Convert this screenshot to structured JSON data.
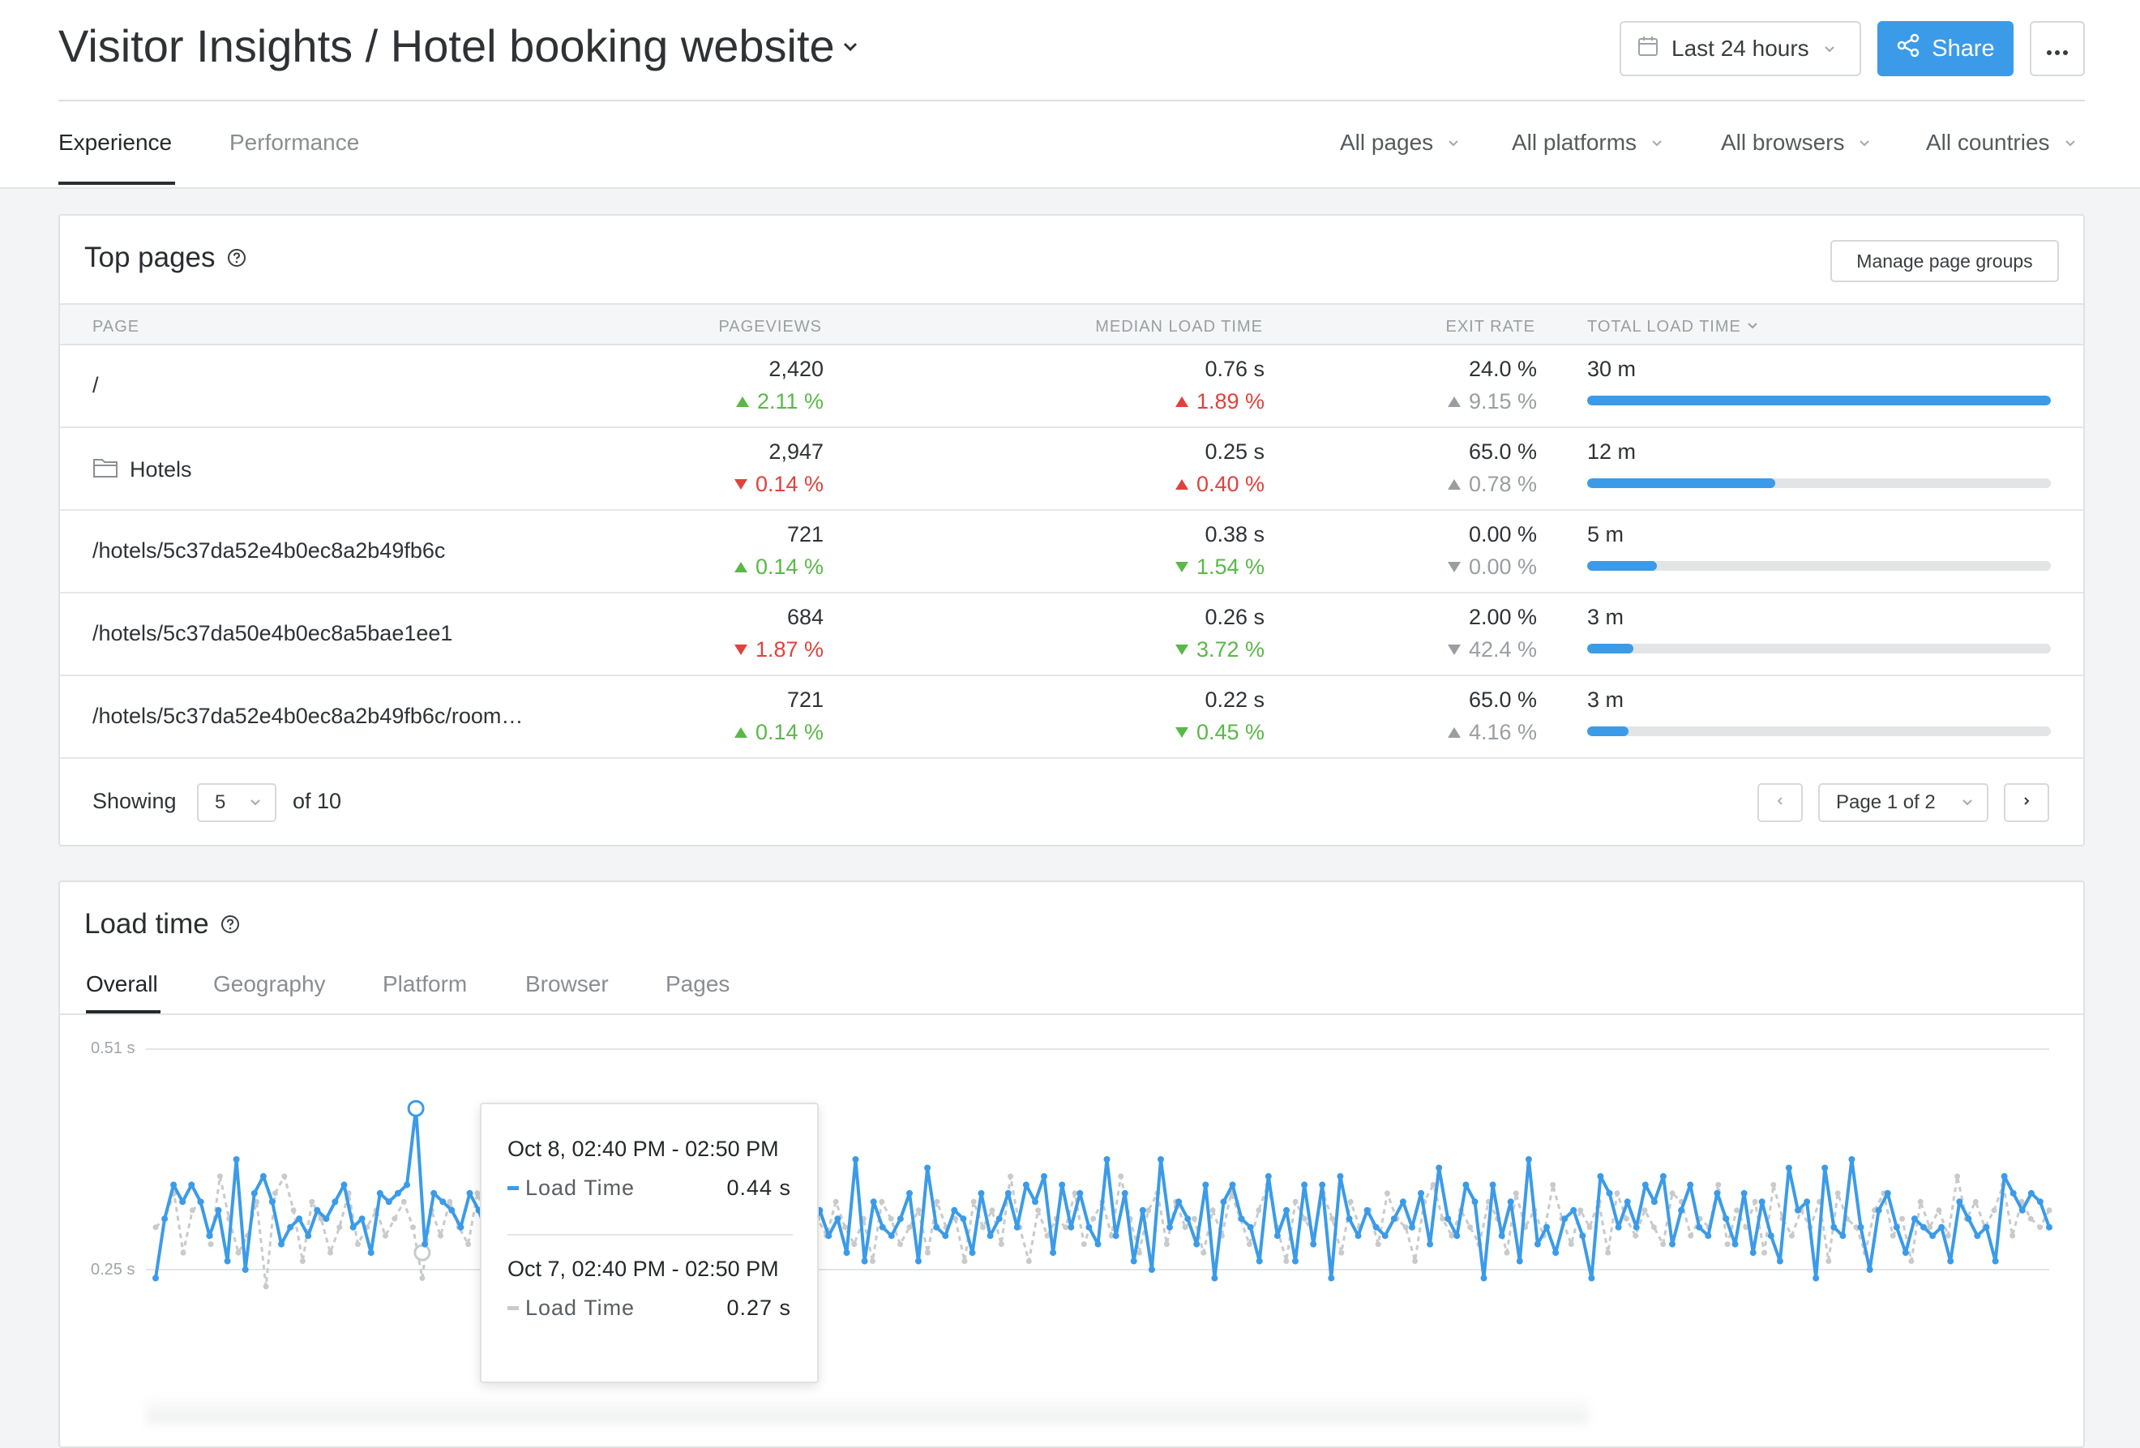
{
  "header": {
    "title": "Visitor Insights / Hotel booking website",
    "date_range": "Last 24 hours",
    "share_label": "Share"
  },
  "tabs": [
    {
      "label": "Experience",
      "active": true
    },
    {
      "label": "Performance",
      "active": false
    }
  ],
  "filters": [
    "All pages",
    "All platforms",
    "All browsers",
    "All countries"
  ],
  "top_pages": {
    "title": "Top pages",
    "manage_label": "Manage page groups",
    "columns": {
      "page": "PAGE",
      "pageviews": "PAGEVIEWS",
      "median_load": "MEDIAN LOAD TIME",
      "exit_rate": "EXIT RATE",
      "total_load": "TOTAL LOAD TIME"
    },
    "rows": [
      {
        "page": "/",
        "is_group": false,
        "pageviews": "2,420",
        "pv_delta": "2.11 %",
        "pv_dir": "up-green",
        "median": "0.76 s",
        "med_delta": "1.89 %",
        "med_dir": "up-red",
        "exit": "24.0 %",
        "exit_delta": "9.15 %",
        "exit_dir": "up-neutral",
        "total": "30 m",
        "total_fraction": 1.0
      },
      {
        "page": "Hotels",
        "is_group": true,
        "pageviews": "2,947",
        "pv_delta": "0.14 %",
        "pv_dir": "down-red",
        "median": "0.25 s",
        "med_delta": "0.40 %",
        "med_dir": "up-red",
        "exit": "65.0 %",
        "exit_delta": "0.78 %",
        "exit_dir": "up-neutral",
        "total": "12 m",
        "total_fraction": 0.405
      },
      {
        "page": "/hotels/5c37da52e4b0ec8a2b49fb6c",
        "is_group": false,
        "pageviews": "721",
        "pv_delta": "0.14 %",
        "pv_dir": "up-green",
        "median": "0.38 s",
        "med_delta": "1.54 %",
        "med_dir": "down-green",
        "exit": "0.00 %",
        "exit_delta": "0.00 %",
        "exit_dir": "down-neutral",
        "total": "5 m",
        "total_fraction": 0.15
      },
      {
        "page": "/hotels/5c37da50e4b0ec8a5bae1ee1",
        "is_group": false,
        "pageviews": "684",
        "pv_delta": "1.87 %",
        "pv_dir": "down-red",
        "median": "0.26 s",
        "med_delta": "3.72 %",
        "med_dir": "down-green",
        "exit": "2.00 %",
        "exit_delta": "42.4 %",
        "exit_dir": "down-neutral",
        "total": "3 m",
        "total_fraction": 0.1
      },
      {
        "page": "/hotels/5c37da52e4b0ec8a2b49fb6c/room…",
        "is_group": false,
        "pageviews": "721",
        "pv_delta": "0.14 %",
        "pv_dir": "up-green",
        "median": "0.22 s",
        "med_delta": "0.45 %",
        "med_dir": "down-green",
        "exit": "65.0 %",
        "exit_delta": "4.16 %",
        "exit_dir": "up-neutral",
        "total": "3 m",
        "total_fraction": 0.09
      }
    ],
    "footer": {
      "showing_label": "Showing",
      "page_size": "5",
      "of_label": "of 10",
      "page_select": "Page 1 of 2"
    }
  },
  "load_time": {
    "title": "Load time",
    "subtabs": [
      "Overall",
      "Geography",
      "Platform",
      "Browser",
      "Pages"
    ],
    "active_subtab": "Overall",
    "tooltip": {
      "current_range": "Oct 8, 02:40 PM - 02:50 PM",
      "current_label": "Load Time",
      "current_value": "0.44 s",
      "previous_range": "Oct 7, 02:40 PM - 02:50 PM",
      "previous_label": "Load Time",
      "previous_value": "0.27 s"
    }
  },
  "colors": {
    "accent": "#3b9be8",
    "green": "#58b947",
    "red": "#e2413b",
    "neutral": "#9a9ea2",
    "previous_series": "#c8cacc"
  },
  "chart_data": {
    "type": "line",
    "ytick_labels": [
      "0.25 s",
      "0.51 s"
    ],
    "ylim": [
      0.25,
      0.51
    ],
    "grid": true,
    "series": [
      {
        "values": [
          0.24,
          0.31,
          0.35,
          0.33,
          0.35,
          0.33,
          0.29,
          0.32,
          0.26,
          0.38,
          0.25,
          0.34,
          0.36,
          0.33,
          0.28,
          0.3,
          0.31,
          0.29,
          0.32,
          0.31,
          0.33,
          0.35,
          0.3,
          0.31,
          0.27,
          0.34,
          0.33,
          0.34,
          0.35,
          0.44,
          0.28,
          0.34,
          0.33,
          0.32,
          0.3,
          0.34,
          0.32,
          0.29,
          0.36,
          0.33,
          0.29,
          0.28,
          0.32,
          0.31,
          0.28,
          0.34,
          0.31,
          0.28,
          0.33,
          0.36,
          0.35,
          0.3,
          0.32,
          0.29,
          0.31,
          0.26,
          0.35,
          0.33,
          0.31,
          0.3,
          0.32,
          0.29,
          0.38,
          0.25,
          0.34,
          0.31,
          0.3,
          0.26,
          0.37,
          0.31,
          0.28,
          0.3,
          0.33,
          0.29,
          0.32,
          0.29,
          0.31,
          0.27,
          0.38,
          0.26,
          0.33,
          0.3,
          0.29,
          0.31,
          0.34,
          0.26,
          0.37,
          0.3,
          0.29,
          0.32,
          0.31,
          0.27,
          0.34,
          0.29,
          0.31,
          0.34,
          0.3,
          0.35,
          0.33,
          0.36,
          0.27,
          0.35,
          0.3,
          0.34,
          0.3,
          0.28,
          0.38,
          0.29,
          0.34,
          0.26,
          0.32,
          0.25,
          0.38,
          0.3,
          0.33,
          0.31,
          0.28,
          0.35,
          0.24,
          0.33,
          0.35,
          0.31,
          0.3,
          0.26,
          0.36,
          0.29,
          0.32,
          0.26,
          0.35,
          0.28,
          0.35,
          0.24,
          0.36,
          0.31,
          0.29,
          0.32,
          0.3,
          0.29,
          0.31,
          0.33,
          0.3,
          0.34,
          0.28,
          0.37,
          0.31,
          0.29,
          0.35,
          0.33,
          0.24,
          0.35,
          0.29,
          0.33,
          0.26,
          0.38,
          0.28,
          0.3,
          0.27,
          0.31,
          0.32,
          0.29,
          0.24,
          0.36,
          0.34,
          0.3,
          0.33,
          0.3,
          0.35,
          0.33,
          0.36,
          0.28,
          0.32,
          0.35,
          0.3,
          0.29,
          0.34,
          0.31,
          0.28,
          0.34,
          0.27,
          0.33,
          0.29,
          0.26,
          0.37,
          0.32,
          0.33,
          0.24,
          0.37,
          0.3,
          0.29,
          0.38,
          0.3,
          0.25,
          0.32,
          0.34,
          0.3,
          0.27,
          0.31,
          0.3,
          0.29,
          0.3,
          0.26,
          0.33,
          0.31,
          0.29,
          0.3,
          0.26,
          0.36,
          0.34,
          0.32,
          0.34,
          0.33,
          0.3
        ],
        "highlight": {
          "index": 29,
          "value": 0.44
        }
      },
      {
        "values": [
          0.3,
          0.31,
          0.34,
          0.27,
          0.32,
          0.33,
          0.28,
          0.36,
          0.31,
          0.27,
          0.29,
          0.33,
          0.23,
          0.34,
          0.36,
          0.32,
          0.26,
          0.33,
          0.31,
          0.27,
          0.3,
          0.34,
          0.28,
          0.3,
          0.32,
          0.29,
          0.31,
          0.33,
          0.3,
          0.24,
          0.32,
          0.29,
          0.33,
          0.3,
          0.28,
          0.34,
          0.31,
          0.3,
          0.33,
          0.28,
          0.31,
          0.3,
          0.29,
          0.32,
          0.3,
          0.33,
          0.31,
          0.29,
          0.33,
          0.3,
          0.32,
          0.31,
          0.3,
          0.29,
          0.34,
          0.31,
          0.27,
          0.33,
          0.3,
          0.32,
          0.29,
          0.36,
          0.26,
          0.31,
          0.33,
          0.3,
          0.28,
          0.34,
          0.31,
          0.27,
          0.32,
          0.3,
          0.31,
          0.29,
          0.33,
          0.3,
          0.28,
          0.31,
          0.26,
          0.33,
          0.31,
          0.28,
          0.3,
          0.32,
          0.27,
          0.33,
          0.3,
          0.31,
          0.26,
          0.33,
          0.3,
          0.32,
          0.28,
          0.36,
          0.3,
          0.26,
          0.32,
          0.29,
          0.31,
          0.3,
          0.34,
          0.28,
          0.31,
          0.33,
          0.29,
          0.36,
          0.31,
          0.27,
          0.32,
          0.34,
          0.28,
          0.33,
          0.3,
          0.31,
          0.27,
          0.32,
          0.29,
          0.34,
          0.31,
          0.28,
          0.32,
          0.35,
          0.3,
          0.26,
          0.33,
          0.31,
          0.29,
          0.34,
          0.31,
          0.27,
          0.33,
          0.3,
          0.32,
          0.28,
          0.34,
          0.31,
          0.3,
          0.26,
          0.33,
          0.35,
          0.31,
          0.29,
          0.32,
          0.3,
          0.28,
          0.33,
          0.31,
          0.27,
          0.34,
          0.3,
          0.32,
          0.29,
          0.35,
          0.31,
          0.28,
          0.32,
          0.3,
          0.33,
          0.27,
          0.34,
          0.31,
          0.29,
          0.32,
          0.3,
          0.28,
          0.34,
          0.33,
          0.29,
          0.31,
          0.3,
          0.35,
          0.28,
          0.32,
          0.3,
          0.33,
          0.27,
          0.35,
          0.31,
          0.29,
          0.32,
          0.3,
          0.33,
          0.26,
          0.34,
          0.31,
          0.3,
          0.27,
          0.32,
          0.34,
          0.29,
          0.31,
          0.26,
          0.33,
          0.3,
          0.32,
          0.29,
          0.36,
          0.31,
          0.33,
          0.3,
          0.32,
          0.35,
          0.29,
          0.33,
          0.31,
          0.3,
          0.32
        ],
        "style": "dotted",
        "highlight": {
          "index": 29,
          "value": 0.27
        }
      }
    ]
  }
}
